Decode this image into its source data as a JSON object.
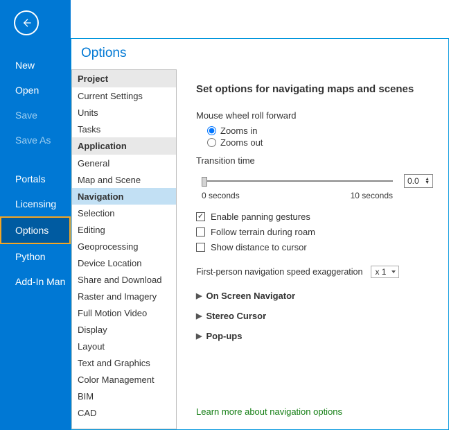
{
  "backstage": {
    "items": [
      {
        "label": "New",
        "state": "normal"
      },
      {
        "label": "Open",
        "state": "normal"
      },
      {
        "label": "Save",
        "state": "disabled"
      },
      {
        "label": "Save As",
        "state": "disabled"
      },
      {
        "label": "Portals",
        "state": "normal"
      },
      {
        "label": "Licensing",
        "state": "normal"
      },
      {
        "label": "Options",
        "state": "selected"
      },
      {
        "label": "Python",
        "state": "normal"
      },
      {
        "label": "Add-In Man",
        "state": "normal"
      }
    ]
  },
  "panel": {
    "title": "Options"
  },
  "categories": {
    "project_header": "Project",
    "project_items": [
      "Current Settings",
      "Units",
      "Tasks"
    ],
    "application_header": "Application",
    "application_items": [
      "General",
      "Map and Scene",
      "Navigation",
      "Selection",
      "Editing",
      "Geoprocessing",
      "Device Location",
      "Share and Download",
      "Raster and Imagery",
      "Full Motion Video",
      "Display",
      "Layout",
      "Text and Graphics",
      "Color Management",
      "BIM",
      "CAD"
    ],
    "selected": "Navigation"
  },
  "detail": {
    "heading": "Set options for navigating maps and scenes",
    "mouse_label": "Mouse wheel roll forward",
    "zoom_in": "Zooms in",
    "zoom_out": "Zooms out",
    "transition_label": "Transition time",
    "transition_value": "0.0",
    "transition_min": "0 seconds",
    "transition_max": "10 seconds",
    "enable_panning": "Enable panning gestures",
    "follow_terrain": "Follow terrain during roam",
    "show_distance": "Show distance to cursor",
    "speed_label": "First-person navigation speed exaggeration",
    "speed_value": "x 1",
    "expanders": [
      "On Screen Navigator",
      "Stereo Cursor",
      "Pop-ups"
    ],
    "link": "Learn more about navigation options"
  }
}
